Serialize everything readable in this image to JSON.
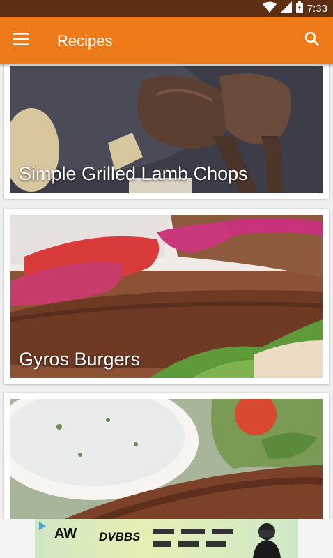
{
  "status_bar": {
    "time": "7:33"
  },
  "app_bar": {
    "title": "Recipes"
  },
  "recipes": [
    {
      "title": "Simple Grilled Lamb Chops"
    },
    {
      "title": "Gyros Burgers"
    },
    {
      "title": ""
    }
  ],
  "ad": {
    "headline": "DVBBS",
    "brand": "AW"
  },
  "colors": {
    "status_bar": "#5c2f12",
    "app_bar": "#ef7a1a",
    "background": "#efefef"
  }
}
